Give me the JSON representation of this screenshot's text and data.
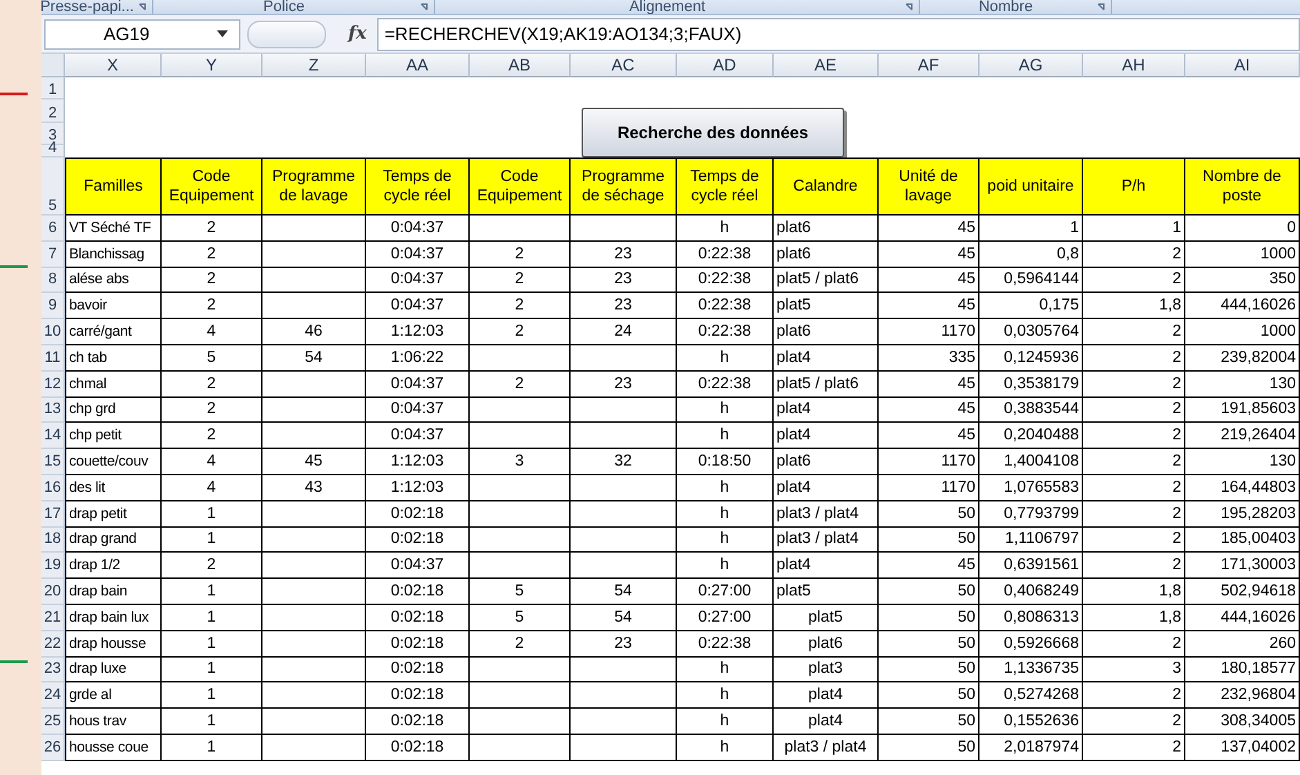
{
  "ribbon_groups": [
    {
      "label": "Presse-papi..."
    },
    {
      "label": "Police"
    },
    {
      "label": "Alignement"
    },
    {
      "label": "Nombre"
    }
  ],
  "formula_bar": {
    "name_box": "AG19",
    "fx": "fx",
    "formula": "=RECHERCHEV(X19;AK19:AO134;3;FAUX)"
  },
  "column_headers": [
    "X",
    "Y",
    "Z",
    "AA",
    "AB",
    "AC",
    "AD",
    "AE",
    "AF",
    "AG",
    "AH",
    "AI"
  ],
  "top_rows": [
    "1",
    "2",
    "3",
    "4"
  ],
  "button": {
    "label": "Recherche des données"
  },
  "header_row": {
    "num": "5",
    "cells": [
      "Familles",
      "Code Equipement",
      "Programme de lavage",
      "Temps de cycle réel",
      "Code Equipement",
      "Programme de séchage",
      "Temps de cycle réel",
      "Calandre",
      "Unité de lavage",
      "poid unitaire",
      "P/h",
      "Nombre de poste"
    ]
  },
  "rows": [
    {
      "num": "6",
      "calandre_centered": false,
      "cells": [
        "VT Séché TF",
        "2",
        null,
        "0:04:37",
        null,
        null,
        "h",
        "plat6",
        "45",
        "1",
        "1",
        "0"
      ]
    },
    {
      "num": "7",
      "calandre_centered": false,
      "cells": [
        "Blanchissag",
        "2",
        null,
        "0:04:37",
        "2",
        "23",
        "0:22:38",
        "plat6",
        "45",
        "0,8",
        "2",
        "1000"
      ]
    },
    {
      "num": "8",
      "calandre_centered": false,
      "cells": [
        "alése abs",
        "2",
        null,
        "0:04:37",
        "2",
        "23",
        "0:22:38",
        "plat5 / plat6",
        "45",
        "0,5964144",
        "2",
        "350"
      ]
    },
    {
      "num": "9",
      "calandre_centered": false,
      "cells": [
        "bavoir",
        "2",
        null,
        "0:04:37",
        "2",
        "23",
        "0:22:38",
        "plat5",
        "45",
        "0,175",
        "1,8",
        "444,16026"
      ]
    },
    {
      "num": "10",
      "calandre_centered": false,
      "cells": [
        "carré/gant",
        "4",
        "46",
        "1:12:03",
        "2",
        "24",
        "0:22:38",
        "plat6",
        "1170",
        "0,0305764",
        "2",
        "1000"
      ]
    },
    {
      "num": "11",
      "calandre_centered": false,
      "cells": [
        "ch tab",
        "5",
        "54",
        "1:06:22",
        null,
        null,
        "h",
        "plat4",
        "335",
        "0,1245936",
        "2",
        "239,82004"
      ]
    },
    {
      "num": "12",
      "calandre_centered": false,
      "cells": [
        "chmal",
        "2",
        null,
        "0:04:37",
        "2",
        "23",
        "0:22:38",
        "plat5 / plat6",
        "45",
        "0,3538179",
        "2",
        "130"
      ]
    },
    {
      "num": "13",
      "calandre_centered": false,
      "cells": [
        "chp grd",
        "2",
        null,
        "0:04:37",
        null,
        null,
        "h",
        "plat4",
        "45",
        "0,3883544",
        "2",
        "191,85603"
      ]
    },
    {
      "num": "14",
      "calandre_centered": false,
      "cells": [
        "chp petit",
        "2",
        null,
        "0:04:37",
        null,
        null,
        "h",
        "plat4",
        "45",
        "0,2040488",
        "2",
        "219,26404"
      ]
    },
    {
      "num": "15",
      "calandre_centered": false,
      "cells": [
        "couette/couv",
        "4",
        "45",
        "1:12:03",
        "3",
        "32",
        "0:18:50",
        "plat6",
        "1170",
        "1,4004108",
        "2",
        "130"
      ]
    },
    {
      "num": "16",
      "calandre_centered": false,
      "cells": [
        "des lit",
        "4",
        "43",
        "1:12:03",
        null,
        null,
        "h",
        "plat4",
        "1170",
        "1,0765583",
        "2",
        "164,44803"
      ]
    },
    {
      "num": "17",
      "calandre_centered": false,
      "cells": [
        "drap petit",
        "1",
        null,
        "0:02:18",
        null,
        null,
        "h",
        "plat3 / plat4",
        "50",
        "0,7793799",
        "2",
        "195,28203"
      ]
    },
    {
      "num": "18",
      "calandre_centered": false,
      "cells": [
        "drap grand",
        "1",
        null,
        "0:02:18",
        null,
        null,
        "h",
        "plat3 / plat4",
        "50",
        "1,1106797",
        "2",
        "185,00403"
      ]
    },
    {
      "num": "19",
      "calandre_centered": false,
      "cells": [
        "drap 1/2",
        "2",
        null,
        "0:04:37",
        null,
        null,
        "h",
        "plat4",
        "45",
        "0,6391561",
        "2",
        "171,30003"
      ]
    },
    {
      "num": "20",
      "calandre_centered": false,
      "cells": [
        "drap bain",
        "1",
        null,
        "0:02:18",
        "5",
        "54",
        "0:27:00",
        "plat5",
        "50",
        "0,4068249",
        "1,8",
        "502,94618"
      ]
    },
    {
      "num": "21",
      "calandre_centered": true,
      "cells": [
        "drap bain lux",
        "1",
        null,
        "0:02:18",
        "5",
        "54",
        "0:27:00",
        "plat5",
        "50",
        "0,8086313",
        "1,8",
        "444,16026"
      ]
    },
    {
      "num": "22",
      "calandre_centered": true,
      "cells": [
        "drap housse",
        "1",
        null,
        "0:02:18",
        "2",
        "23",
        "0:22:38",
        "plat6",
        "50",
        "0,5926668",
        "2",
        "260"
      ]
    },
    {
      "num": "23",
      "calandre_centered": true,
      "cells": [
        "drap luxe",
        "1",
        null,
        "0:02:18",
        null,
        null,
        "h",
        "plat3",
        "50",
        "1,1336735",
        "3",
        "180,18577"
      ]
    },
    {
      "num": "24",
      "calandre_centered": true,
      "cells": [
        "grde al",
        "1",
        null,
        "0:02:18",
        null,
        null,
        "h",
        "plat4",
        "50",
        "0,5274268",
        "2",
        "232,96804"
      ]
    },
    {
      "num": "25",
      "calandre_centered": true,
      "cells": [
        "hous trav",
        "1",
        null,
        "0:02:18",
        null,
        null,
        "h",
        "plat4",
        "50",
        "0,1552636",
        "2",
        "308,34005"
      ]
    },
    {
      "num": "26",
      "calandre_centered": true,
      "cells": [
        "housse coue",
        "1",
        null,
        "0:02:18",
        null,
        null,
        "h",
        "plat3 / plat4",
        "50",
        "2,0187974",
        "2",
        "137,04002"
      ]
    }
  ]
}
